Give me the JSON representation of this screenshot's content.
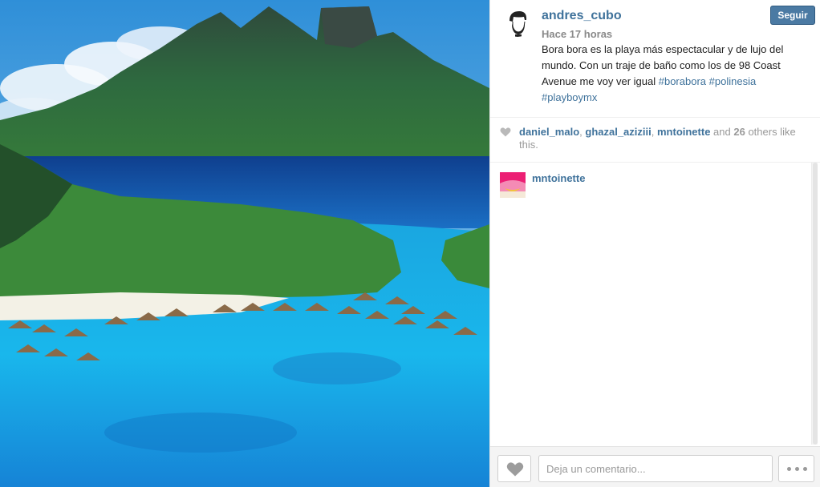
{
  "post": {
    "username": "andres_cubo",
    "time": "Hace 17 horas",
    "caption_text": "Bora bora es la playa más espectacular y de lujo del mundo. Con un traje de baño como los de 98 Coast Avenue me voy ver igual ",
    "hashtags": [
      "#borabora",
      "#polinesia",
      "#playboymx"
    ],
    "follow_label": "Seguir"
  },
  "likes": {
    "likers": [
      "daniel_malo",
      "ghazal_aziziii",
      "mntoinette"
    ],
    "separator": ", ",
    "and_text": " and ",
    "others_count": "26",
    "suffix": " others like this."
  },
  "comments": [
    {
      "username": "mntoinette",
      "text": ""
    }
  ],
  "footer": {
    "comment_placeholder": "Deja un comentario..."
  },
  "colors": {
    "link": "#3f729b",
    "follow_button": "#4b7aa3"
  },
  "icons": {
    "like": "heart-icon",
    "more": "ellipsis-icon"
  }
}
